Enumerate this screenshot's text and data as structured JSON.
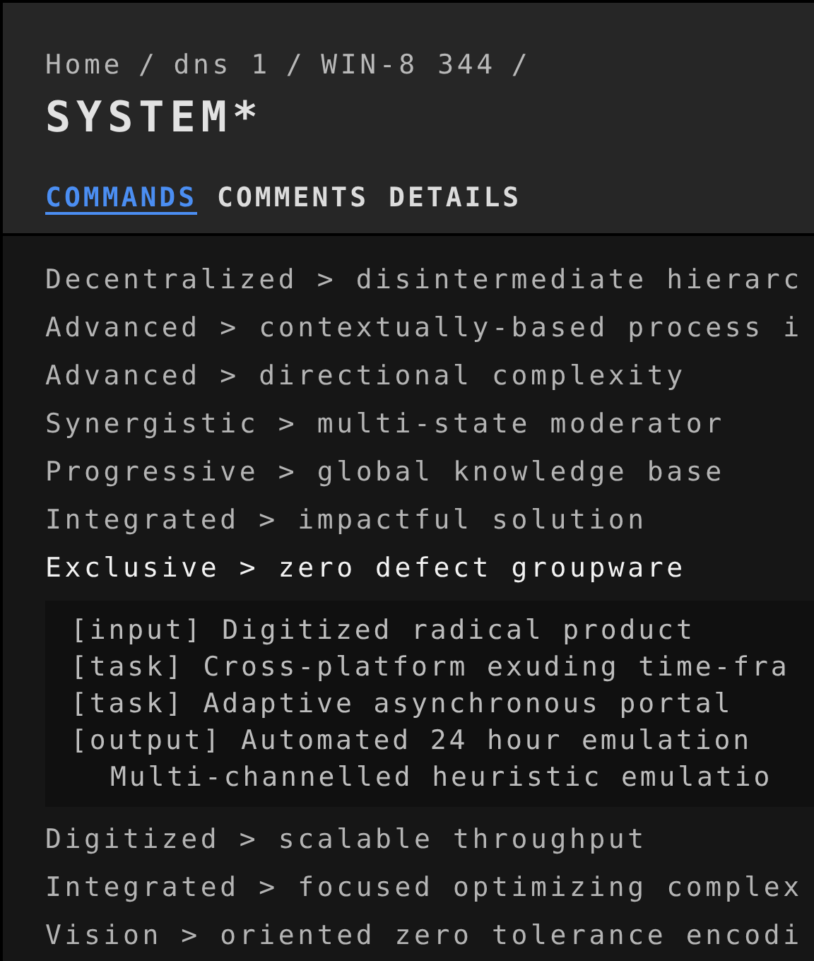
{
  "breadcrumb": [
    {
      "label": "Home",
      "separator": "/"
    },
    {
      "label": "dns 1",
      "separator": "/"
    },
    {
      "label": "WIN-8 344",
      "separator": "/"
    }
  ],
  "title": "SYSTEM*",
  "tabs": [
    {
      "label": "COMMANDS",
      "selected": true
    },
    {
      "label": "COMMENTS",
      "selected": false
    },
    {
      "label": "DETAILS",
      "selected": false
    }
  ],
  "rows": [
    {
      "text": "Decentralized > disintermediate hierarc",
      "selected": false
    },
    {
      "text": "Advanced > contextually-based process i",
      "selected": false
    },
    {
      "text": "Advanced > directional complexity",
      "selected": false
    },
    {
      "text": "Synergistic > multi-state moderator",
      "selected": false
    },
    {
      "text": "Progressive > global knowledge base",
      "selected": false
    },
    {
      "text": "Integrated > impactful solution",
      "selected": false
    },
    {
      "text": "Exclusive > zero defect groupware",
      "selected": true,
      "details": [
        {
          "text": "[input] Digitized radical product"
        },
        {
          "text": "[task] Cross-platform exuding time-fra"
        },
        {
          "text": "[task] Adaptive asynchronous portal"
        },
        {
          "text": "[output] Automated 24 hour emulation",
          "children": [
            {
              "text": "Multi-channelled heuristic emulatio"
            }
          ]
        }
      ]
    },
    {
      "text": "Digitized > scalable throughput",
      "selected": false
    },
    {
      "text": "Integrated > focused optimizing complex",
      "selected": false
    },
    {
      "text": "Vision > oriented zero tolerance encodi",
      "selected": false
    }
  ]
}
